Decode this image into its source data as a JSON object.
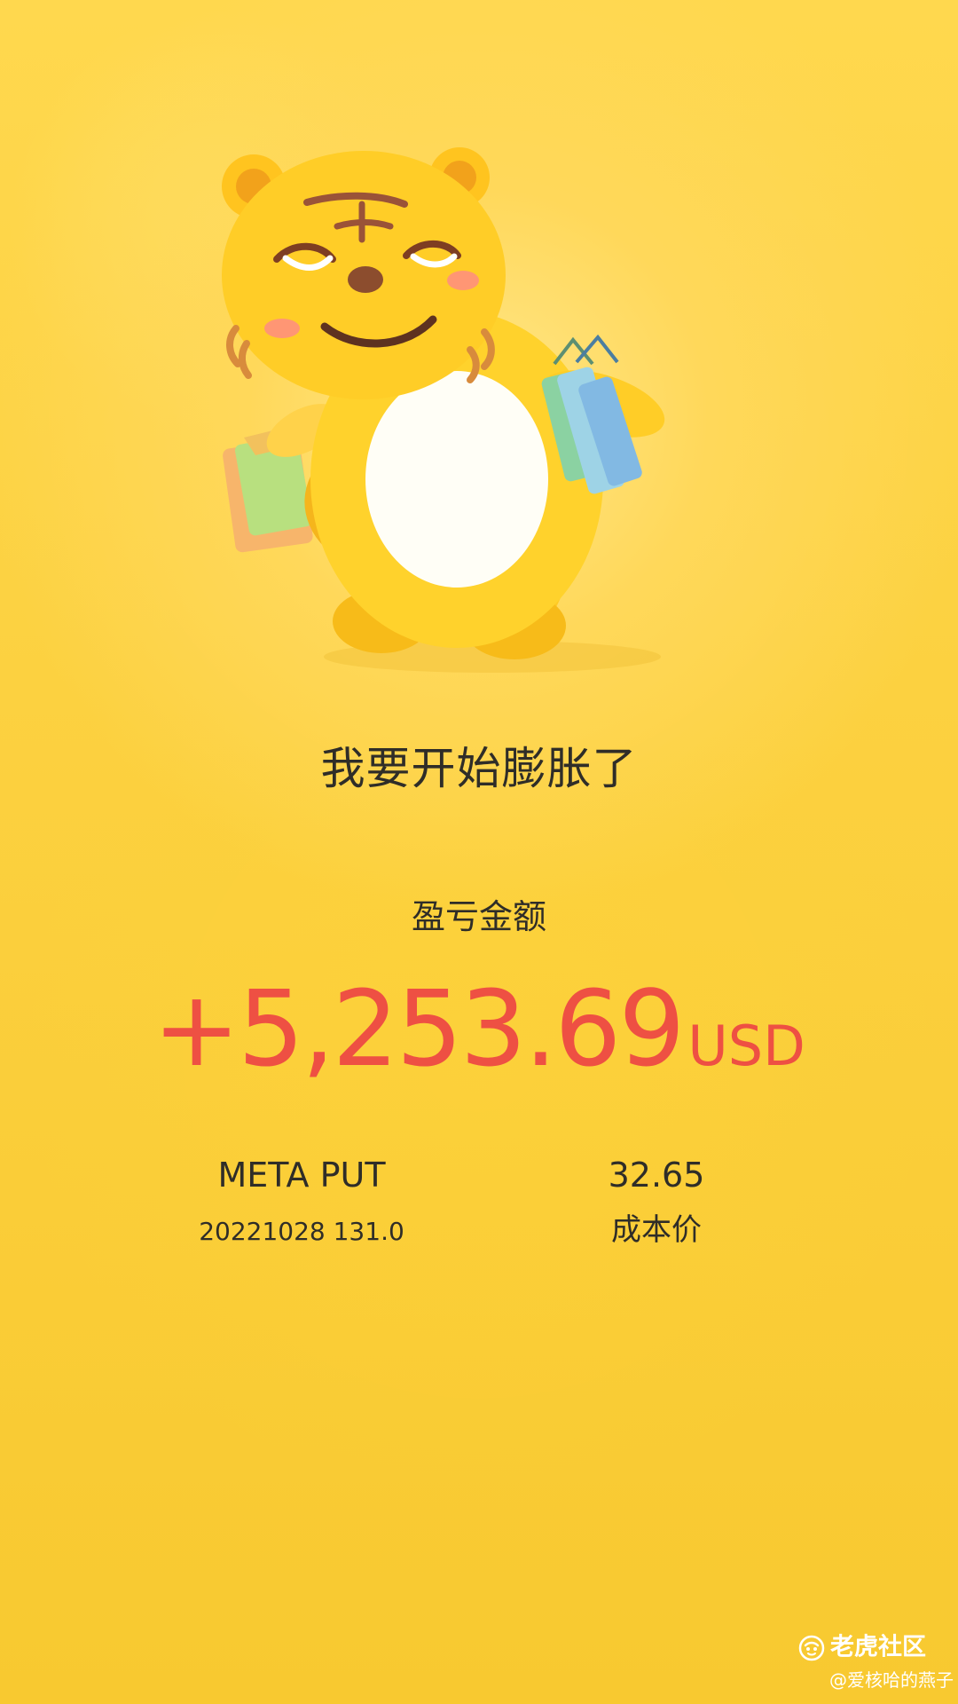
{
  "headline": "我要开始膨胀了",
  "profit": {
    "label": "盈亏金额",
    "amount": "+5,253.69",
    "currency": "USD",
    "color": "#ee5043"
  },
  "position": {
    "name": "META PUT",
    "contract": "20221028 131.0",
    "cost_value": "32.65",
    "cost_label": "成本价"
  },
  "watermark": {
    "brand": "老虎社区",
    "handle": "@爱核哈的燕子"
  },
  "icons": {
    "mascot": "tiger-mascot-shopping-illustration",
    "brand": "tiger-community-logo-icon"
  },
  "colors": {
    "background": "#fcd140",
    "text": "#2f2d28",
    "profit": "#ee5043"
  }
}
